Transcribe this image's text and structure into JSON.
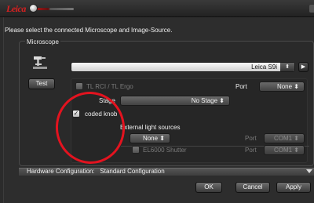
{
  "titlebar": {
    "logo_text": "Leica"
  },
  "dialog": {
    "prompt": "Please select the connected Microscope and Image-Source.",
    "microscope_group_label": "Microscope",
    "microscope_select_value": "Leica S9i",
    "test_button": "Test",
    "tl_rci_label": "TL RCI / TL Ergo",
    "tl_port_label": "Port",
    "tl_port_value": "None",
    "stage_label": "Stage",
    "stage_value": "No Stage",
    "coded_knob_label": "coded knob",
    "coded_knob_checked": true,
    "external_light_label": "External light sources",
    "ext_light_value": "None",
    "ext_port_label": "Port",
    "ext_port_value": "COM1",
    "el6000_label": "EL6000 Shutter",
    "el6000_port_label": "Port",
    "el6000_port_value": "COM1",
    "hardware_config_label": "Hardware Configuration:",
    "hardware_config_value": "Standard Configuration",
    "ok_button": "OK",
    "cancel_button": "Cancel",
    "apply_button": "Apply"
  },
  "colors": {
    "accent_red": "#e3131f",
    "logo_red": "#d92020"
  }
}
